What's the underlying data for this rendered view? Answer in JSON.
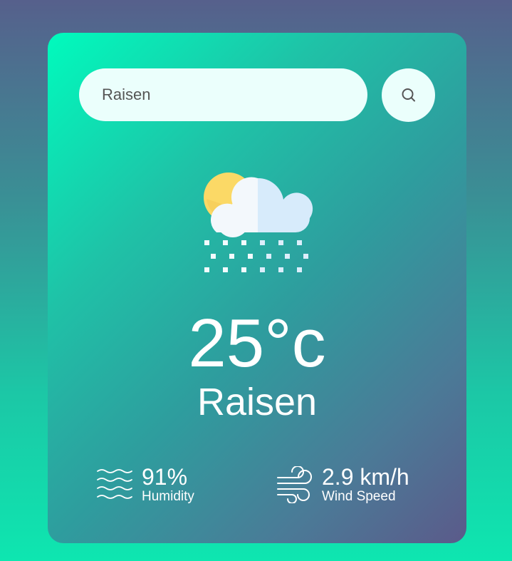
{
  "search": {
    "value": "Raisen",
    "placeholder": ""
  },
  "icons": {
    "search_button": "search-icon",
    "weather": "sun-cloud-snow-icon",
    "humidity": "humidity-waves-icon",
    "wind": "wind-icon"
  },
  "weather": {
    "temperature": "25°c",
    "city": "Raisen"
  },
  "details": {
    "humidity_value": "91%",
    "humidity_label": "Humidity",
    "wind_value": "2.9 km/h",
    "wind_label": "Wind Speed"
  },
  "colors": {
    "card_gradient_start": "#00fbbd",
    "card_gradient_end": "#5b5a8a",
    "input_background": "#ebfffc",
    "text": "#ffffff"
  }
}
